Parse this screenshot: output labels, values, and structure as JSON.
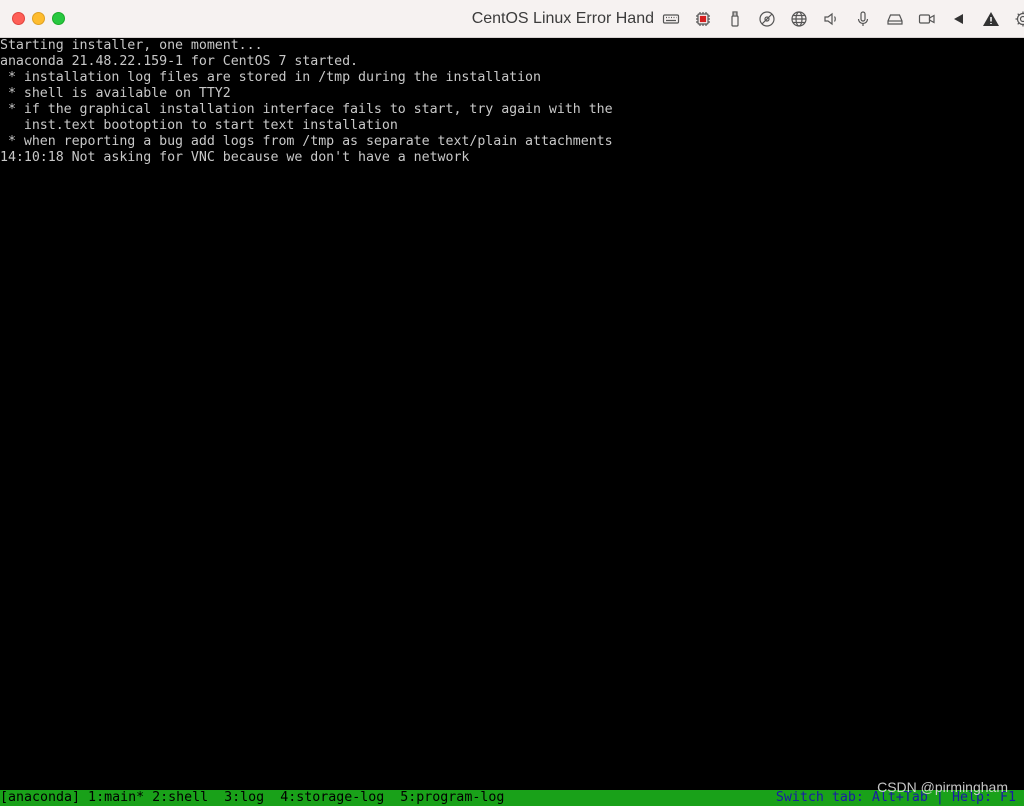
{
  "window": {
    "title": "CentOS Linux Error Hand"
  },
  "toolbar": {
    "icons": [
      "keyboard-icon",
      "cpu-icon",
      "usb-icon",
      "cd-icon",
      "network-icon",
      "speaker-icon",
      "microphone-icon",
      "drive-icon",
      "camera-icon",
      "back-icon",
      "warning-icon",
      "gear-icon"
    ]
  },
  "console": {
    "lines": [
      "Starting installer, one moment...",
      "anaconda 21.48.22.159-1 for CentOS 7 started.",
      " * installation log files are stored in /tmp during the installation",
      " * shell is available on TTY2",
      " * if the graphical installation interface fails to start, try again with the",
      "   inst.text bootoption to start text installation",
      " * when reporting a bug add logs from /tmp as separate text/plain attachments",
      "14:10:18 Not asking for VNC because we don't have a network"
    ]
  },
  "statusbar": {
    "left": "[anaconda] 1:main* 2:shell  3:log  4:storage-log  5:program-log",
    "right": "Switch tab: Alt+Tab | Help: F1"
  },
  "watermark": "CSDN @pirmingham",
  "colors": {
    "titlebar": "#f6f2f1",
    "console_bg": "#000000",
    "console_text": "#c8c8c8",
    "statusbar_bg": "#19a119",
    "statusbar_right_text": "#1a1aa6"
  }
}
